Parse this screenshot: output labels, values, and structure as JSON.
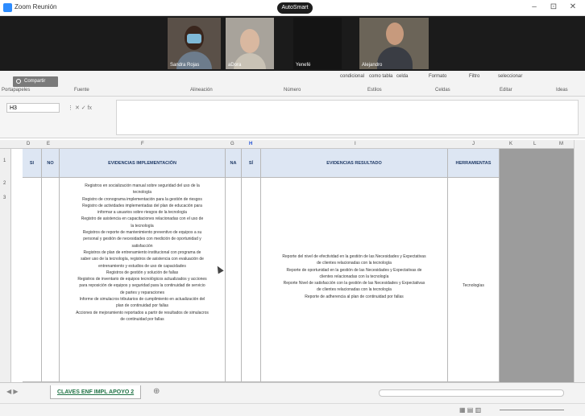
{
  "window": {
    "app_title": "Zoom Reunión",
    "view_pill": "AutoSmart"
  },
  "participants": [
    {
      "name": "Sandra Rojas"
    },
    {
      "name": "aDora"
    },
    {
      "name": "Yenefé"
    },
    {
      "name": "Alejandro"
    }
  ],
  "ribbon": {
    "search_label": "Compartir",
    "items": [
      "condicional",
      "como tabla",
      "celda",
      "Formato",
      "Filtro",
      "seleccionar"
    ],
    "groups": [
      "Portapapeles",
      "Fuente",
      "Alineación",
      "Número",
      "Estilos",
      "Celdas",
      "Editar",
      "Ideas"
    ]
  },
  "formula_bar": {
    "cell_ref": "H3"
  },
  "columns": [
    "D",
    "E",
    "F",
    "G",
    "H",
    "I",
    "J",
    "K",
    "L",
    "M"
  ],
  "rows": [
    "1",
    "2",
    "3"
  ],
  "table": {
    "headers": {
      "si_left": "SI",
      "no": "NO",
      "evidencias": "EVIDENCIAS IMPLEMENTACIÓN",
      "na": "NA",
      "si_right": "SÍ",
      "evidencias_resultado": "EVIDENCIAS RESULTADO",
      "herramientas": "HERRAMIENTAS"
    },
    "evidencias_lines": [
      "Registros en socialización manual sobre seguridad del uso de la",
      "tecnología",
      "Registro de cronograma implementación para la gestión de riesgos",
      "Registro de actividades implementadas del plan de educación para",
      "informar a usuarios sobre riesgos de la tecnología",
      "Registro de asistencia en capacitaciones relacionadas con el uso de",
      "la tecnología",
      "Registros de reporte de mantenimiento preventivo de equipos a su",
      "personal y gestión de necesidades con medición de oportunidad y",
      "satisfacción",
      "Registros de plan de entrenamiento institucional con programa de",
      "saber uso de la tecnología, registros de asistencia con evaluación de",
      "entrenamiento y estudios de uso de capacidades",
      "Registros de gestión y solución de fallas",
      "Registros de inventario de equipos tecnológicos actualizados y acciones",
      "para reposición de equipos y seguridad para la continuidad de servicio",
      "de partes y reparaciones",
      "Informe de simulacros tributarios de cumplimiento en actualización del",
      "plan de continuidad por fallas",
      "Acciones de mejoramiento reportados a partir de resultados de simulacros",
      "de continuidad por fallas"
    ],
    "resultado_lines": [
      "Reporte del nivel de efectividad en la gestión de las Necesidades y Expectativas",
      "de clientes relacionadas con la tecnología",
      "Reporte de oportunidad en la gestión de las Necesidades y Expectativas de",
      "clientes relacionadas con la tecnología",
      "Reporte Nivel de satisfacción con la gestión de las Necesidades y Expectativas",
      "de clientes relacionadas con la tecnología",
      "Reporte de adherencia al plan de continuidad por fallas"
    ],
    "herramientas_value": "Tecnologías"
  },
  "sheet_tab": "CLAVES ENF IMPL APOYO 2",
  "colors": {
    "header_fill": "#dde6f3",
    "sheet_tab_text": "#217346",
    "selection_blue": "#1f4fd6"
  }
}
